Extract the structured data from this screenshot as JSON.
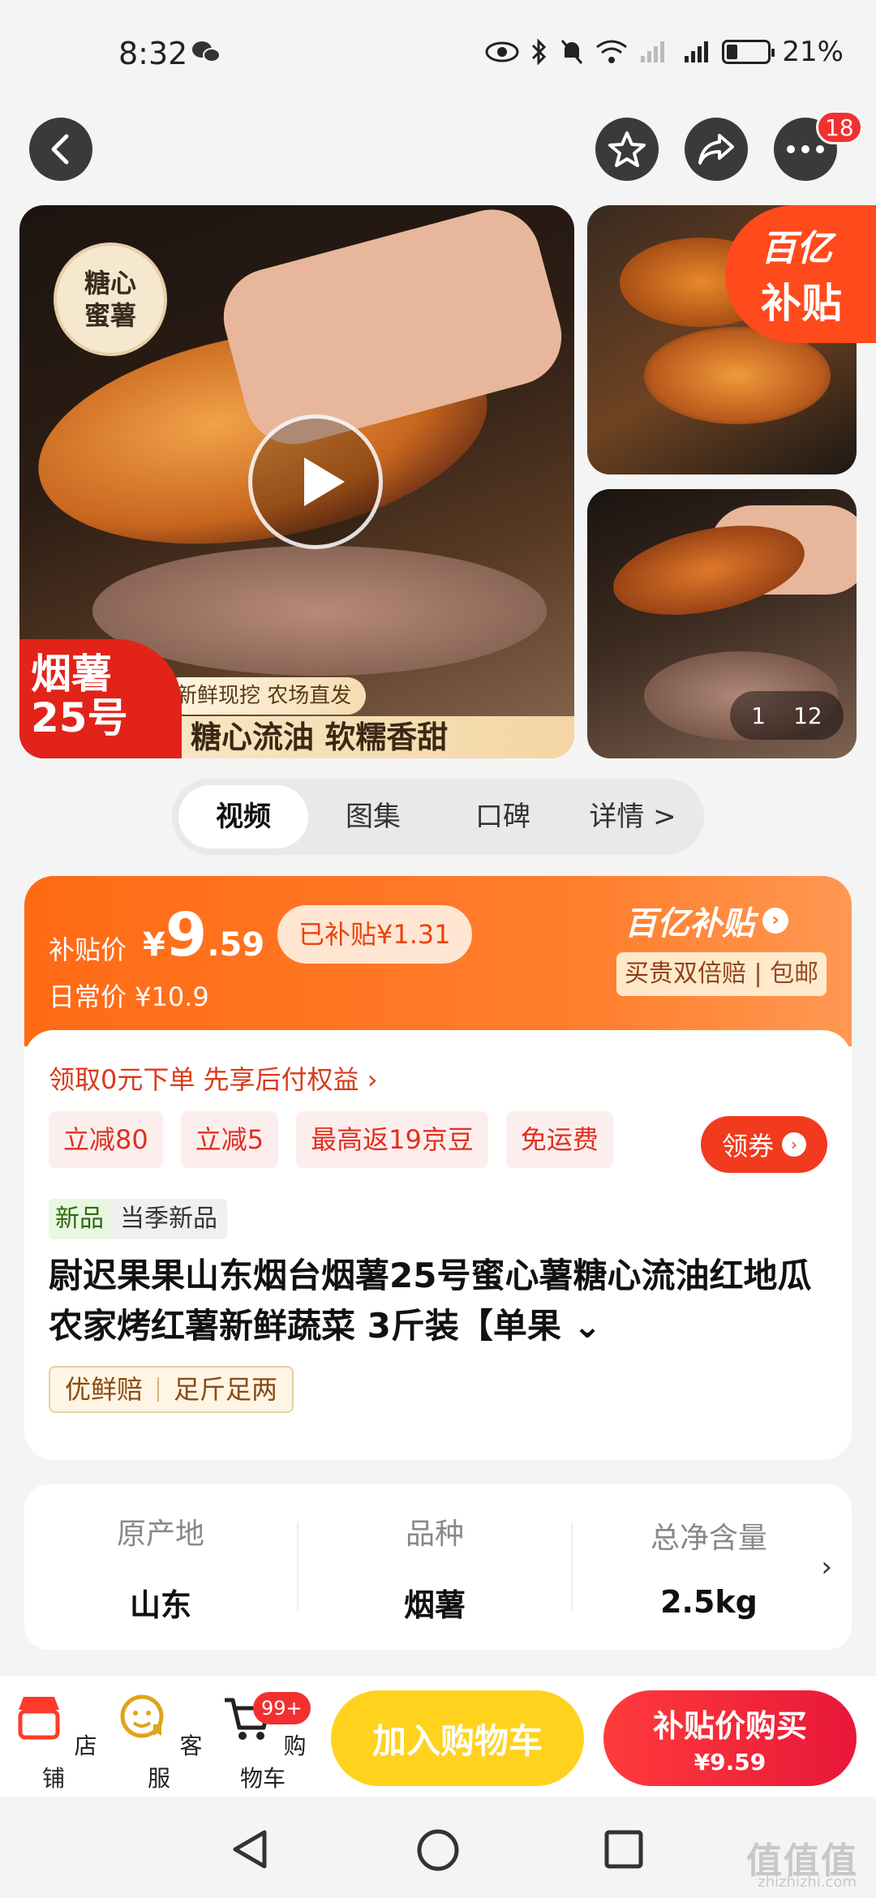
{
  "status_bar": {
    "time": "8:32",
    "battery": "21%"
  },
  "nav": {
    "cart_badge_count": "18"
  },
  "gallery": {
    "tag_line1": "糖心",
    "tag_line2": "蜜薯",
    "red_tag_line1": "烟薯",
    "red_tag_line2": "25号",
    "banner_small": "新鲜现挖 农场直发",
    "banner_big": "糖心流油 软糯香甜",
    "corner_line1": "百亿",
    "corner_line2": "补贴",
    "counter_current": "1",
    "counter_total": "12"
  },
  "tabs": [
    "视频",
    "图集",
    "口碑",
    "详情 >"
  ],
  "price": {
    "label": "补贴价",
    "yen": "¥",
    "int": "9",
    "dec": ".59",
    "subsidized": "已补贴¥1.31",
    "daily": "日常价 ¥10.9",
    "brand": "百亿补贴",
    "brand_sub": "买贵双倍赔 | 包邮"
  },
  "promo": {
    "rights": "领取0元下单 先享后付权益 ›",
    "chips": [
      "立减80",
      "立减5",
      "最高返19京豆",
      "免运费"
    ],
    "coupon": "领券"
  },
  "product": {
    "new_tag": "新品",
    "new_desc": "当季新品",
    "title": "尉迟果果山东烟台烟薯25号蜜心薯糖心流油红地瓜农家烤红薯新鲜蔬菜 3斤装【单果 ⌄",
    "feature1": "优鲜赔",
    "feature2": "足斤足两"
  },
  "specs": [
    {
      "k": "原产地",
      "v": "山东"
    },
    {
      "k": "品种",
      "v": "烟薯"
    },
    {
      "k": "总净含量",
      "v": "2.5kg"
    }
  ],
  "bottom_bar": {
    "store": "店铺",
    "service": "客服",
    "cart": "购物车",
    "cart_badge": "99+",
    "add_to_cart": "加入购物车",
    "buy_line1": "补贴价购买",
    "buy_line2": "¥9.59"
  },
  "watermark": {
    "main": "值值值",
    "sub": "zhizhizhi.com"
  }
}
